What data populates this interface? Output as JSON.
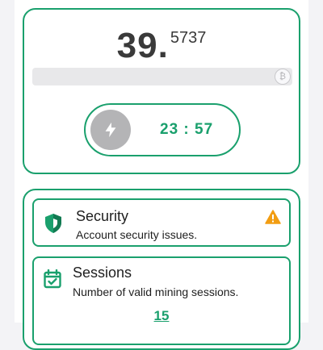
{
  "balance": {
    "integer": "39.",
    "decimal": "5737"
  },
  "mining": {
    "timer": "23 : 57",
    "progress": 0,
    "coin_symbol": "₿"
  },
  "security": {
    "title": "Security",
    "subtitle": "Account security issues."
  },
  "sessions": {
    "title": "Sessions",
    "subtitle": "Number of valid mining sessions.",
    "count": "15"
  },
  "colors": {
    "accent": "#1aa06d",
    "warning": "#f29d12",
    "disabled": "#b4b4b6"
  },
  "icons": {
    "coin": "coin-icon",
    "mine": "lightning-bolt-icon",
    "security": "shield-icon",
    "warning": "warning-triangle-icon",
    "sessions": "calendar-check-icon"
  }
}
